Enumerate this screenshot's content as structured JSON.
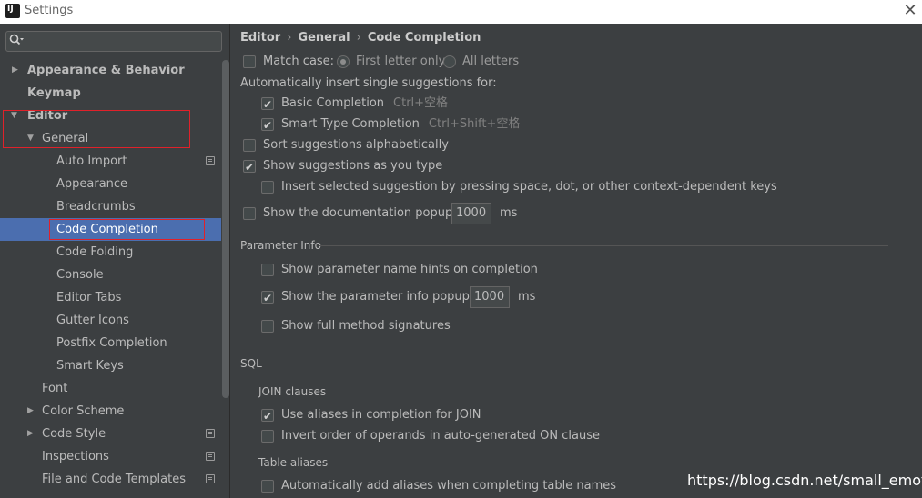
{
  "window": {
    "title": "Settings",
    "close_glyph": "✕"
  },
  "search": {
    "icon": "search-icon",
    "placeholder": ""
  },
  "sidebar": {
    "items": [
      {
        "label": "Appearance & Behavior",
        "bold": true,
        "arrow": "▶"
      },
      {
        "label": "Keymap",
        "bold": true,
        "arrow": ""
      },
      {
        "label": "Editor",
        "bold": true,
        "arrow": "▼"
      },
      {
        "label": "General",
        "bold": false,
        "arrow": "▼"
      },
      {
        "label": "Auto Import"
      },
      {
        "label": "Appearance"
      },
      {
        "label": "Breadcrumbs"
      },
      {
        "label": "Code Completion"
      },
      {
        "label": "Code Folding"
      },
      {
        "label": "Console"
      },
      {
        "label": "Editor Tabs"
      },
      {
        "label": "Gutter Icons"
      },
      {
        "label": "Postfix Completion"
      },
      {
        "label": "Smart Keys"
      },
      {
        "label": "Font"
      },
      {
        "label": "Color Scheme",
        "arrow": "▶"
      },
      {
        "label": "Code Style",
        "arrow": "▶"
      },
      {
        "label": "Inspections"
      },
      {
        "label": "File and Code Templates"
      }
    ]
  },
  "breadcrumb": {
    "items": [
      "Editor",
      "General",
      "Code Completion"
    ],
    "sep": "›"
  },
  "match_case": {
    "label": "Match case:",
    "first_letter": "First letter only",
    "all_letters": "All letters"
  },
  "auto_insert": {
    "label": "Automatically insert single suggestions for:"
  },
  "basic": {
    "label": "Basic Completion",
    "shortcut": "Ctrl+空格"
  },
  "smart": {
    "label": "Smart Type Completion",
    "shortcut": "Ctrl+Shift+空格"
  },
  "sort": {
    "label": "Sort suggestions alphabetically"
  },
  "show_as_type": {
    "label": "Show suggestions as you type"
  },
  "insert_selected": {
    "label": "Insert selected suggestion by pressing space, dot, or other context-dependent keys"
  },
  "doc_popup": {
    "label": "Show the documentation popup in",
    "value": "1000",
    "unit": "ms"
  },
  "param_info": {
    "title": "Parameter Info",
    "hints": "Show parameter name hints on completion",
    "popup": "Show the parameter info popup in",
    "popup_value": "1000",
    "popup_unit": "ms",
    "full_sig": "Show full method signatures"
  },
  "sql": {
    "title": "SQL",
    "join_title": "JOIN clauses",
    "use_aliases": "Use aliases in completion for JOIN",
    "invert": "Invert order of operands in auto-generated ON clause",
    "table_aliases": "Table aliases",
    "auto_add": "Automatically add aliases when completing table names"
  },
  "watermark": "https://blog.csdn.net/small_emotion",
  "colors": {
    "selection": "#4b6eaf",
    "highlight_box": "#e0212a",
    "background": "#3c3f41"
  }
}
